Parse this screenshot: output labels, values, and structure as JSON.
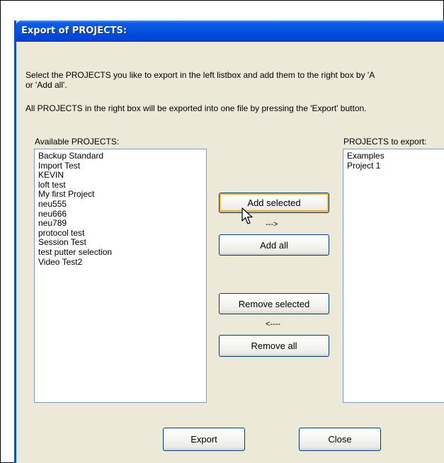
{
  "window": {
    "title": "Export of PROJECTS:"
  },
  "instructions": {
    "line1": "Select the PROJECTS you like to export in the left listbox and add them to the right box by 'A",
    "line2": "or 'Add all'.",
    "line3": "All PROJECTS in the right box will be exported into one file by pressing the 'Export' button."
  },
  "available": {
    "label": "Available PROJECTS:",
    "items": [
      "Backup Standard",
      "Import Test",
      "KEVIN",
      "loft test",
      "My first Project",
      "neu555",
      "neu666",
      "neu789",
      "protocol test",
      "Session Test",
      "test putter selection",
      "Video Test2"
    ]
  },
  "to_export": {
    "label": "PROJECTS to export:",
    "items": [
      "Examples",
      "Project 1"
    ]
  },
  "buttons": {
    "add_selected": "Add selected",
    "add_all": "Add all",
    "remove_selected": "Remove selected",
    "remove_all": "Remove all",
    "export": "Export",
    "close": "Close"
  },
  "arrows": {
    "right": "--->",
    "left": "<----"
  },
  "cursor": "arrow-cursor-icon"
}
